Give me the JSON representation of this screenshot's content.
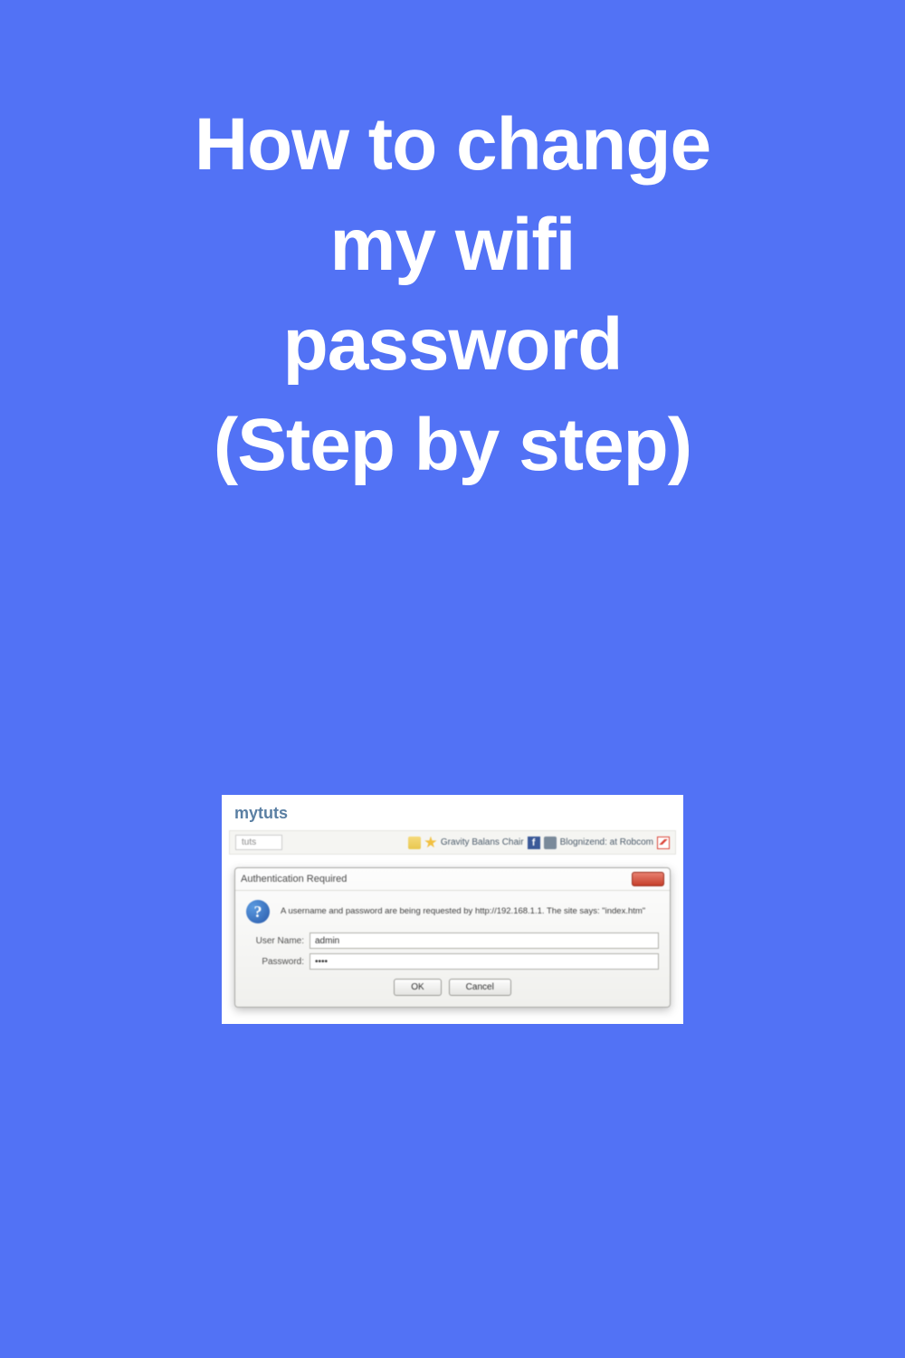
{
  "page_title": "How to change\nmy wifi\npassword\n(Step by step)",
  "screenshot": {
    "brand": "mytuts",
    "toolbar": {
      "url_hint": "tuts",
      "bookmark1": "Gravity Balans Chair",
      "bookmark2": "Blognizend: at Robcom"
    },
    "dialog": {
      "title": "Authentication Required",
      "message": "A username and password are being requested by http://192.168.1.1. The site says: \"index.htm\"",
      "username_label": "User Name:",
      "username_value": "admin",
      "password_label": "Password:",
      "password_value": "••••",
      "ok_label": "OK",
      "cancel_label": "Cancel"
    }
  }
}
